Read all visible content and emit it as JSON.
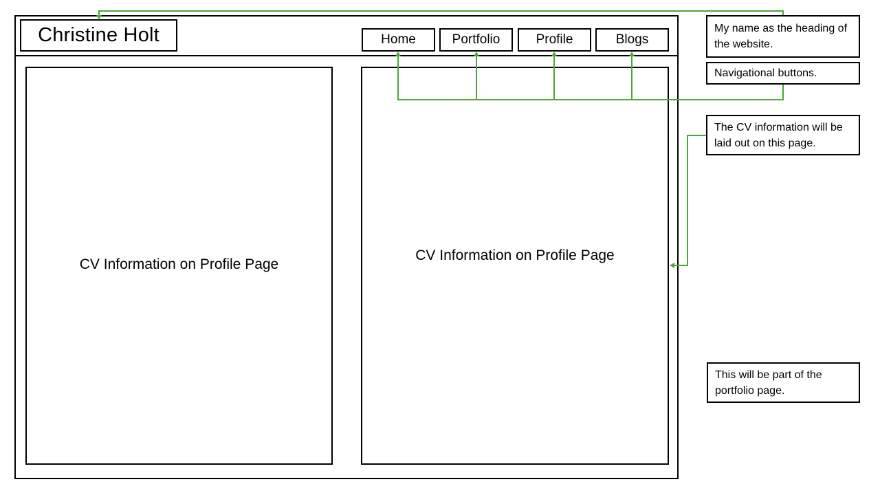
{
  "header": {
    "site_title": "Christine Holt"
  },
  "nav": {
    "items": [
      {
        "label": "Home"
      },
      {
        "label": "Portfolio"
      },
      {
        "label": "Profile"
      },
      {
        "label": "Blogs"
      }
    ]
  },
  "panels": {
    "left_label": "CV Information on Profile Page",
    "right_label": "CV Information on Profile Page"
  },
  "annotations": {
    "heading_note": "My name as the heading of the website.",
    "nav_note": "Navigational buttons.",
    "cv_note": "The CV information will be laid out on this page.",
    "portfolio_note": "This will be part of the portfolio page."
  },
  "colors": {
    "connector": "#4ca63a",
    "outline": "#000000",
    "background": "#ffffff"
  }
}
